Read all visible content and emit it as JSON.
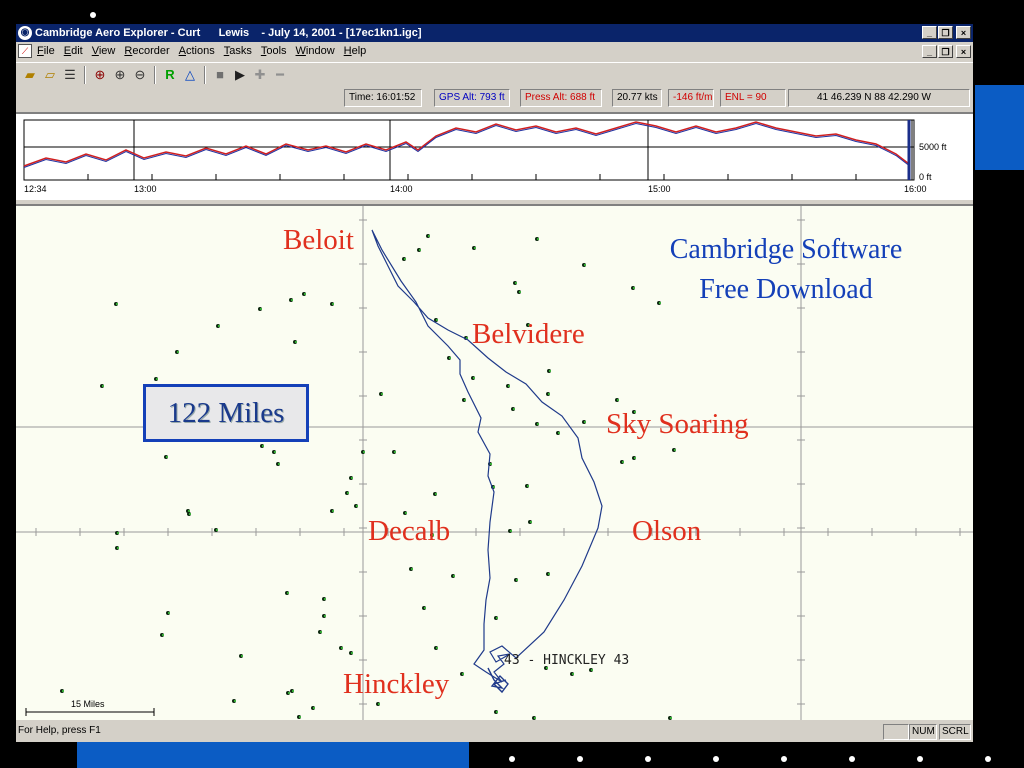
{
  "window": {
    "title": "Cambridge Aero Explorer - Curt      Lewis    - July 14, 2001 - [17ec1kn1.igc]",
    "title_buttons": [
      "_",
      "❐",
      "×"
    ],
    "mdi_buttons": [
      "_",
      "❐",
      "×"
    ]
  },
  "menu": {
    "items": [
      "File",
      "Edit",
      "View",
      "Recorder",
      "Actions",
      "Tasks",
      "Tools",
      "Window",
      "Help"
    ]
  },
  "toolbar": {
    "icons": [
      "open-folder-icon",
      "save-folder-icon",
      "tree-icon",
      "zoom-fit-icon",
      "zoom-in-icon",
      "zoom-out-icon",
      "r-tool-icon",
      "triangle-tool-icon",
      "stop-icon",
      "play-icon",
      "add-icon",
      "remove-icon"
    ]
  },
  "status_top": {
    "time": "Time: 16:01:52",
    "gps_alt": "GPS Alt: 793 ft",
    "press_alt": "Press Alt: 688 ft",
    "speed": "20.77 kts",
    "vario": "-146 ft/m",
    "enl": "ENL = 90",
    "position": "41  46.239 N  88  42.290 W",
    "colors": {
      "gps": "#0000c0",
      "red": "#d00000"
    }
  },
  "profile": {
    "time_labels": [
      "12:34",
      "13:00",
      "14:00",
      "15:00",
      "16:00"
    ],
    "alt_labels": [
      "5000 ft",
      "0 ft"
    ]
  },
  "map": {
    "places": {
      "beloit": "Beloit",
      "belvidere": "Belvidere",
      "sky_soaring": "Sky Soaring",
      "decalb": "Decalb",
      "olson": "Olson",
      "hinckley": "Hinckley"
    },
    "promo_line1": "Cambridge Software",
    "promo_line2": "Free Download",
    "distance": "122 Miles",
    "waypoint_tag": "43 - HINCKLEY 43",
    "scale": "15 Miles",
    "colors": {
      "place": "#e0301e",
      "promo": "#1440b8",
      "track": "#1f3a8a"
    }
  },
  "status_bottom": {
    "help": "For Help, press F1",
    "num": "NUM",
    "scrl": "SCRL"
  }
}
